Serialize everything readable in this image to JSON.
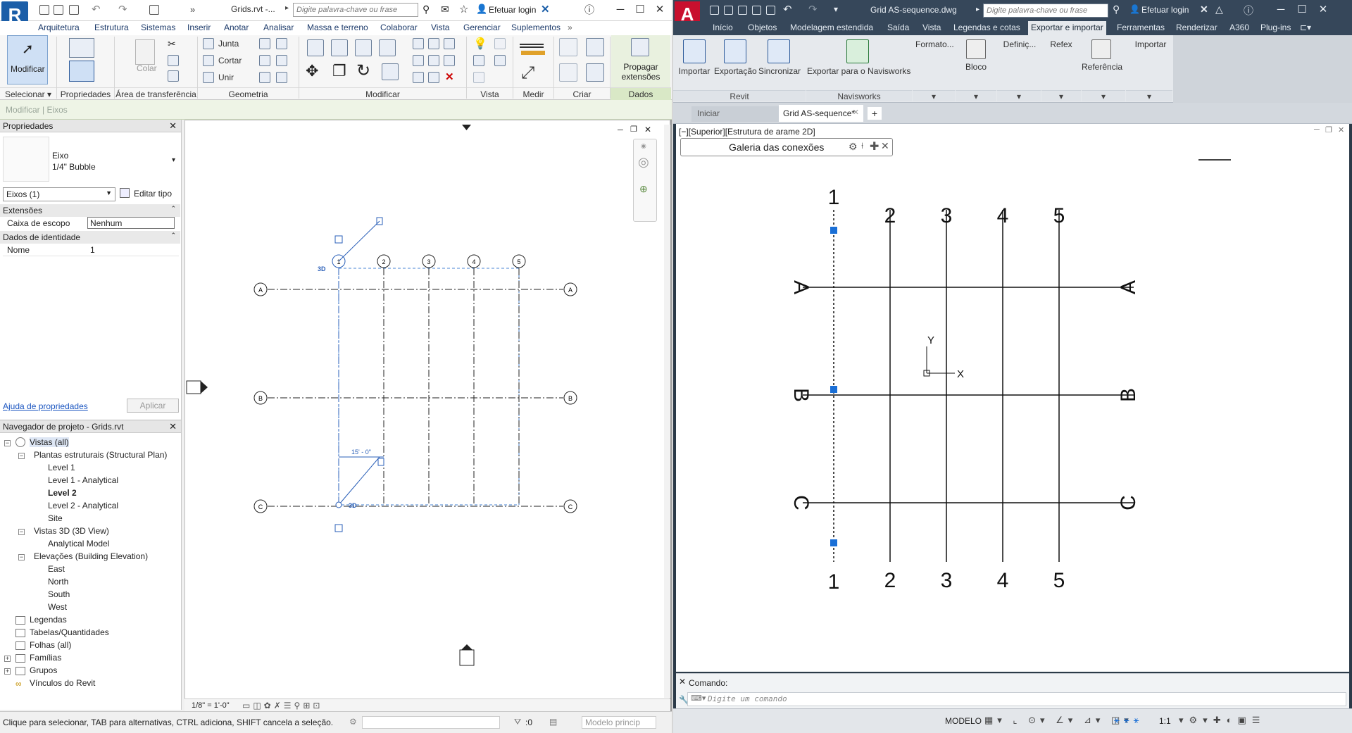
{
  "revit": {
    "logo": "R",
    "title": "Grids.rvt -...",
    "search_placeholder": "Digite palavra-chave ou frase",
    "login": "Efetuar login",
    "tabs": [
      "Arquitetura",
      "Estrutura",
      "Sistemas",
      "Inserir",
      "Anotar",
      "Analisar",
      "Massa e terreno",
      "Colaborar",
      "Vista",
      "Gerenciar",
      "Suplementos"
    ],
    "ribbon": {
      "modify": "Modificar",
      "paste": "Colar",
      "properties": "Propriedades",
      "join": "Junta",
      "cut": "Cortar",
      "unir": "Unir",
      "propagate": "Propagar extensões",
      "panels": [
        "Selecionar",
        "Propriedades",
        "Área de transferência",
        "Geometria",
        "Modificar",
        "Vista",
        "Medir",
        "Criar",
        "Dados"
      ]
    },
    "context": "Modificar | Eixos",
    "properties": {
      "title": "Propriedades",
      "family": "Eixo",
      "type": "1/4\" Bubble",
      "selector": "Eixos (1)",
      "edit_type": "Editar tipo",
      "group_extents": "Extensões",
      "scope_box_label": "Caixa de escopo",
      "scope_box_value": "Nenhum",
      "group_identity": "Dados de identidade",
      "name_label": "Nome",
      "name_value": "1",
      "help_link": "Ajuda de propriedades",
      "apply": "Aplicar"
    },
    "browser": {
      "title": "Navegador de projeto - Grids.rvt",
      "items": [
        "Vistas (all)",
        "Plantas estruturais (Structural Plan)",
        "Level 1",
        "Level 1 - Analytical",
        "Level 2",
        "Level 2 - Analytical",
        "Site",
        "Vistas 3D (3D View)",
        "Analytical Model",
        "Elevações (Building Elevation)",
        "East",
        "North",
        "South",
        "West",
        "Legendas",
        "Tabelas/Quantidades",
        "Folhas (all)",
        "Famílias",
        "Grupos",
        "Vínculos do Revit"
      ]
    },
    "canvas": {
      "columns": [
        "1",
        "2",
        "3",
        "4",
        "5"
      ],
      "rows": [
        "A",
        "B",
        "C"
      ],
      "dimension": "15' - 0\"",
      "tag_3d": "3D",
      "scale": "1/8\" = 1'-0\""
    },
    "status": {
      "hint": "Clique para selecionar, TAB para alternativas, CTRL adiciona, SHIFT cancela a seleção.",
      "filter_count": ":0",
      "model": "Modelo princip"
    }
  },
  "autocad": {
    "logo": "A",
    "title": "Grid AS-sequence.dwg",
    "search_placeholder": "Digite palavra-chave ou frase",
    "login": "Efetuar login",
    "tabs": [
      "Início",
      "Objetos",
      "Modelagem estendida",
      "Saída",
      "Vista",
      "Legendas e cotas",
      "Exportar e importar",
      "Ferramentas",
      "Renderizar",
      "A360",
      "Plug-ins"
    ],
    "ribbon": {
      "buttons": [
        "Importar",
        "Exportação",
        "Sincronizar",
        "Exportar para o Navisworks",
        "Formato...",
        "Bloco",
        "Definiç...",
        "Refex",
        "Referência",
        "Importar"
      ],
      "panels": [
        "Revit",
        "Navisworks"
      ]
    },
    "doc_tabs": [
      "Iniciar",
      "Grid AS-sequence*"
    ],
    "viewport_label": "[−][Superior][Estrutura de arame 2D]",
    "gallery": "Galeria das conexões",
    "columns": [
      "1",
      "2",
      "3",
      "4",
      "5"
    ],
    "rows": [
      "A",
      "B",
      "C"
    ],
    "ucs": {
      "x": "X",
      "y": "Y"
    },
    "command_label": "Comando:",
    "command_placeholder": "Digite um comando",
    "status_model": "MODELO",
    "status_scale": "1:1"
  }
}
